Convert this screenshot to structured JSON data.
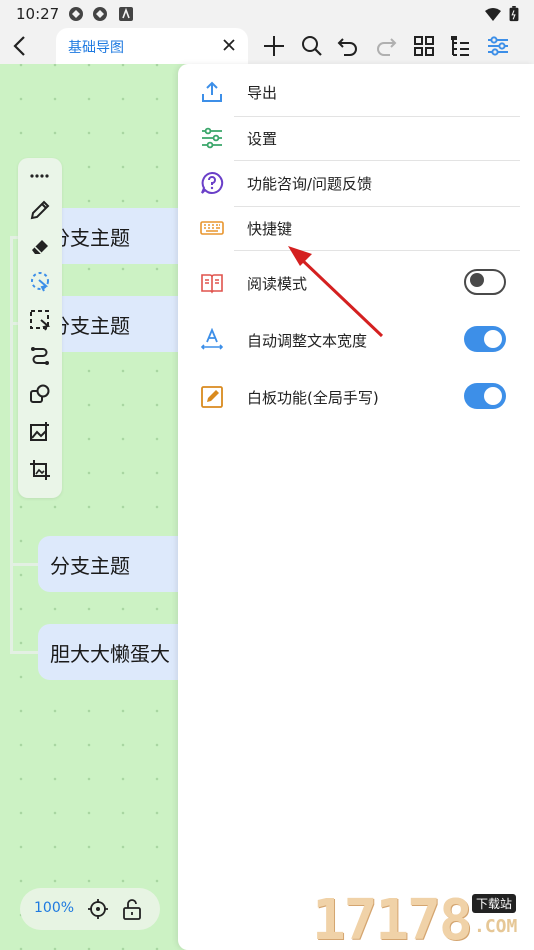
{
  "status_bar": {
    "time": "10:27"
  },
  "toolbar": {
    "tab_title": "基础导图"
  },
  "canvas": {
    "nodes": [
      "分支主题",
      "分支主题",
      "分支主题",
      "胆大大懒蛋大"
    ]
  },
  "zoom": {
    "level": "100%"
  },
  "menu": {
    "items": [
      {
        "label": "导出",
        "icon": "export-icon"
      },
      {
        "label": "设置",
        "icon": "settings-sliders-icon"
      },
      {
        "label": "功能咨询/问题反馈",
        "icon": "help-icon"
      },
      {
        "label": "快捷键",
        "icon": "keyboard-icon"
      },
      {
        "label": "阅读模式",
        "icon": "book-icon",
        "toggle": false
      },
      {
        "label": "自动调整文本宽度",
        "icon": "text-width-icon",
        "toggle": true
      },
      {
        "label": "白板功能(全局手写)",
        "icon": "whiteboard-icon",
        "toggle": true
      }
    ]
  },
  "watermark": {
    "digits": "17178",
    "tag": "下载站",
    "suffix": ".COM"
  },
  "colors": {
    "accent": "#3d8fe8",
    "canvas": "#ccf2c4",
    "node": "#dde9fb",
    "annotation": "#d42020"
  }
}
